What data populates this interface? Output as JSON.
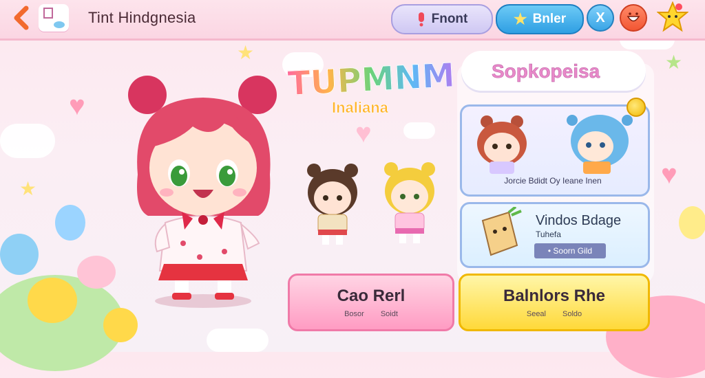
{
  "header": {
    "title": "Tint Hindgnesia",
    "front_label": "Fnont",
    "banner_label": "Bnler",
    "close_label": "X"
  },
  "logo": {
    "main": "TUPMNM",
    "sub": "Inaliana"
  },
  "panel": {
    "title": "Sopkopeisa",
    "card1_caption": "Jorcie Bdidt Oy Ieane Inen",
    "card2_title": "Vindos Bdage",
    "card2_subtitle": "Tuhefa",
    "card2_button": "• Soorn Gild"
  },
  "buttons": {
    "pink": {
      "label": "Cao Rerl",
      "sub_left": "Bosor",
      "sub_right": "Soidt"
    },
    "yellow": {
      "label": "Balnlors Rhe",
      "sub_left": "Seeal",
      "sub_right": "Soldo"
    }
  },
  "colors": {
    "accent_pink": "#ff9cc3",
    "accent_yellow": "#ffd93a",
    "accent_blue": "#2f9fe3",
    "hair_red": "#e24a6a"
  }
}
